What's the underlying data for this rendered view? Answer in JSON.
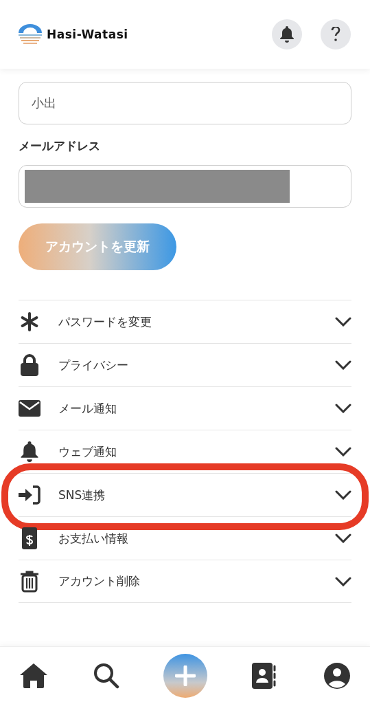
{
  "header": {
    "logo_text": "Hasi-Watasi"
  },
  "form": {
    "name_field": {
      "value": "小出"
    },
    "email_label": "メールアドレス",
    "email_field": {
      "redacted": true
    },
    "submit_button": "アカウントを更新"
  },
  "settings": [
    {
      "label": "パスワードを変更",
      "expanded": false,
      "highlighted": false
    },
    {
      "label": "プライバシー",
      "expanded": false,
      "highlighted": false
    },
    {
      "label": "メール通知",
      "expanded": false,
      "highlighted": false
    },
    {
      "label": "ウェブ通知",
      "expanded": false,
      "highlighted": false
    },
    {
      "label": "SNS連携",
      "expanded": false,
      "highlighted": true
    },
    {
      "label": "お支払い情報",
      "expanded": false,
      "highlighted": false
    },
    {
      "label": "アカウント削除",
      "expanded": false,
      "highlighted": false
    }
  ],
  "bottom_nav": [
    {
      "selected": false
    },
    {
      "selected": false
    },
    {
      "selected": false
    },
    {
      "selected": false
    },
    {
      "selected": false
    }
  ]
}
